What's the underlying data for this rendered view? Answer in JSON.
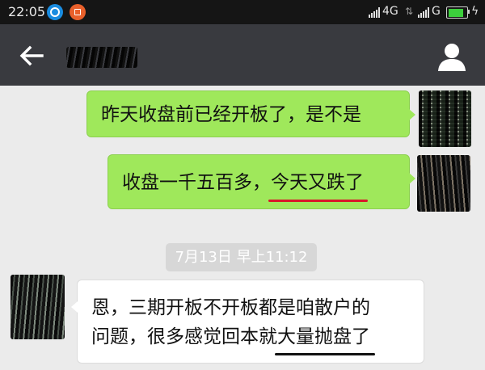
{
  "status_bar": {
    "time": "22:05",
    "network_primary": "4G",
    "network_secondary": "G",
    "battery_level": 0.85,
    "icons": [
      "qq-browser-icon",
      "orange-app-icon",
      "signal-icon",
      "data-arrows-icon",
      "battery-icon",
      "charging-icon"
    ]
  },
  "header": {
    "back_icon": "arrow-left-icon",
    "contact_name": "",
    "profile_icon": "person-icon"
  },
  "messages": [
    {
      "side": "out",
      "text": "昨天收盘前已经开板了，是不是"
    },
    {
      "side": "out",
      "text_plain": "收盘一千五百多，",
      "text_underlined": "今天又跌了",
      "underline_color": "#d8182a"
    },
    {
      "side": "in",
      "line1": "恩，三期开板不开板都是咱散户的",
      "line2_plain": "问题，很多感觉回本就",
      "line2_underlined": "大量抛盘了",
      "underline_color": "#111111"
    }
  ],
  "timestamp": "7月13日 早上11:12",
  "colors": {
    "title_bar": "#393a3f",
    "status_bar": "#151515",
    "chat_background": "#ebebeb",
    "outgoing_bubble": "#9fe85b",
    "incoming_bubble": "#ffffff",
    "timestamp_chip": "#d7d7d7"
  }
}
